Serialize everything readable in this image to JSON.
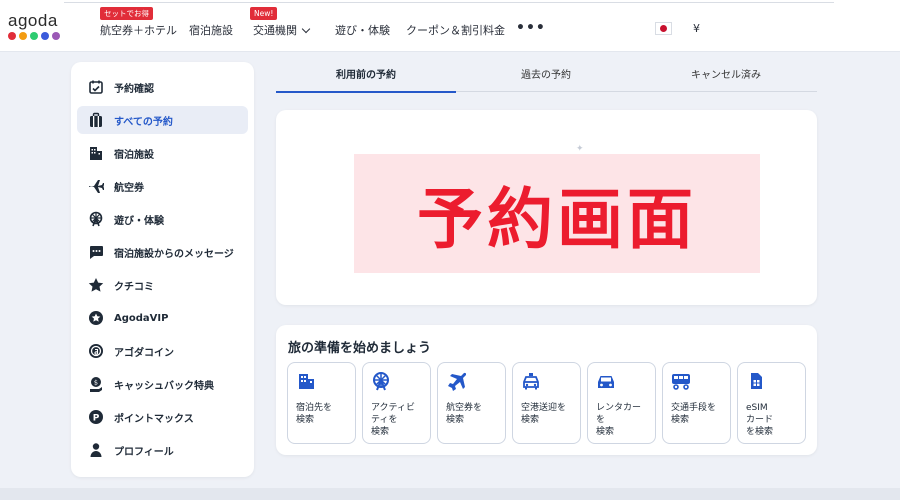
{
  "header": {
    "logo": "agoda",
    "logo_dot_colors": [
      "#e12d39",
      "#f39c12",
      "#2ecc71",
      "#3b5bdb",
      "#9b59b6"
    ],
    "nav": [
      {
        "label": "航空券＋ホテル",
        "badge": "セットでお得"
      },
      {
        "label": "宿泊施設",
        "badge": ""
      },
      {
        "label": "交通機関",
        "badge": "New!"
      },
      {
        "label": "遊び・体験",
        "badge": ""
      },
      {
        "label": "クーポン＆割引料金",
        "badge": ""
      }
    ],
    "more": "•••",
    "currency": "¥"
  },
  "sidebar": {
    "items": [
      {
        "label": "予約確認",
        "icon": "calendar-check-icon"
      },
      {
        "label": "すべての予約",
        "icon": "suitcase-icon"
      },
      {
        "label": "宿泊施設",
        "icon": "building-icon"
      },
      {
        "label": "航空券",
        "icon": "airplane-icon"
      },
      {
        "label": "遊び・体験",
        "icon": "ferris-wheel-icon"
      },
      {
        "label": "宿泊施設からのメッセージ",
        "icon": "message-icon"
      },
      {
        "label": "クチコミ",
        "icon": "star-icon"
      },
      {
        "label": "AgodaVIP",
        "icon": "vip-star-icon"
      },
      {
        "label": "アゴダコイン",
        "icon": "coin-icon"
      },
      {
        "label": "キャッシュバック特典",
        "icon": "cashback-icon"
      },
      {
        "label": "ポイントマックス",
        "icon": "pointsmax-icon"
      },
      {
        "label": "プロフィール",
        "icon": "person-icon"
      }
    ],
    "active_index": 1
  },
  "tabs": [
    {
      "label": "利用前の予約"
    },
    {
      "label": "過去の予約"
    },
    {
      "label": "キャンセル済み"
    }
  ],
  "reservation_banner": {
    "text": "予約画面"
  },
  "prep": {
    "title": "旅の準備を始めましょう",
    "tiles": [
      {
        "label": "宿泊先を\n検索",
        "icon": "hotel-icon"
      },
      {
        "label": "アクティビ\nティを\n検索",
        "icon": "activity-icon"
      },
      {
        "label": "航空券を\n検索",
        "icon": "flight-icon"
      },
      {
        "label": "空港送迎を\n検索",
        "icon": "airport-transfer-icon"
      },
      {
        "label": "レンタカー\nを\n検索",
        "icon": "car-icon"
      },
      {
        "label": "交通手段を\n検索",
        "icon": "train-icon"
      },
      {
        "label": "eSIM\nカード\nを検索",
        "icon": "esim-icon"
      }
    ]
  },
  "colors": {
    "accent": "#2458c9",
    "banner_text": "#ec1c2e",
    "banner_bg": "#fde4e7",
    "badge": "#e12d39"
  }
}
